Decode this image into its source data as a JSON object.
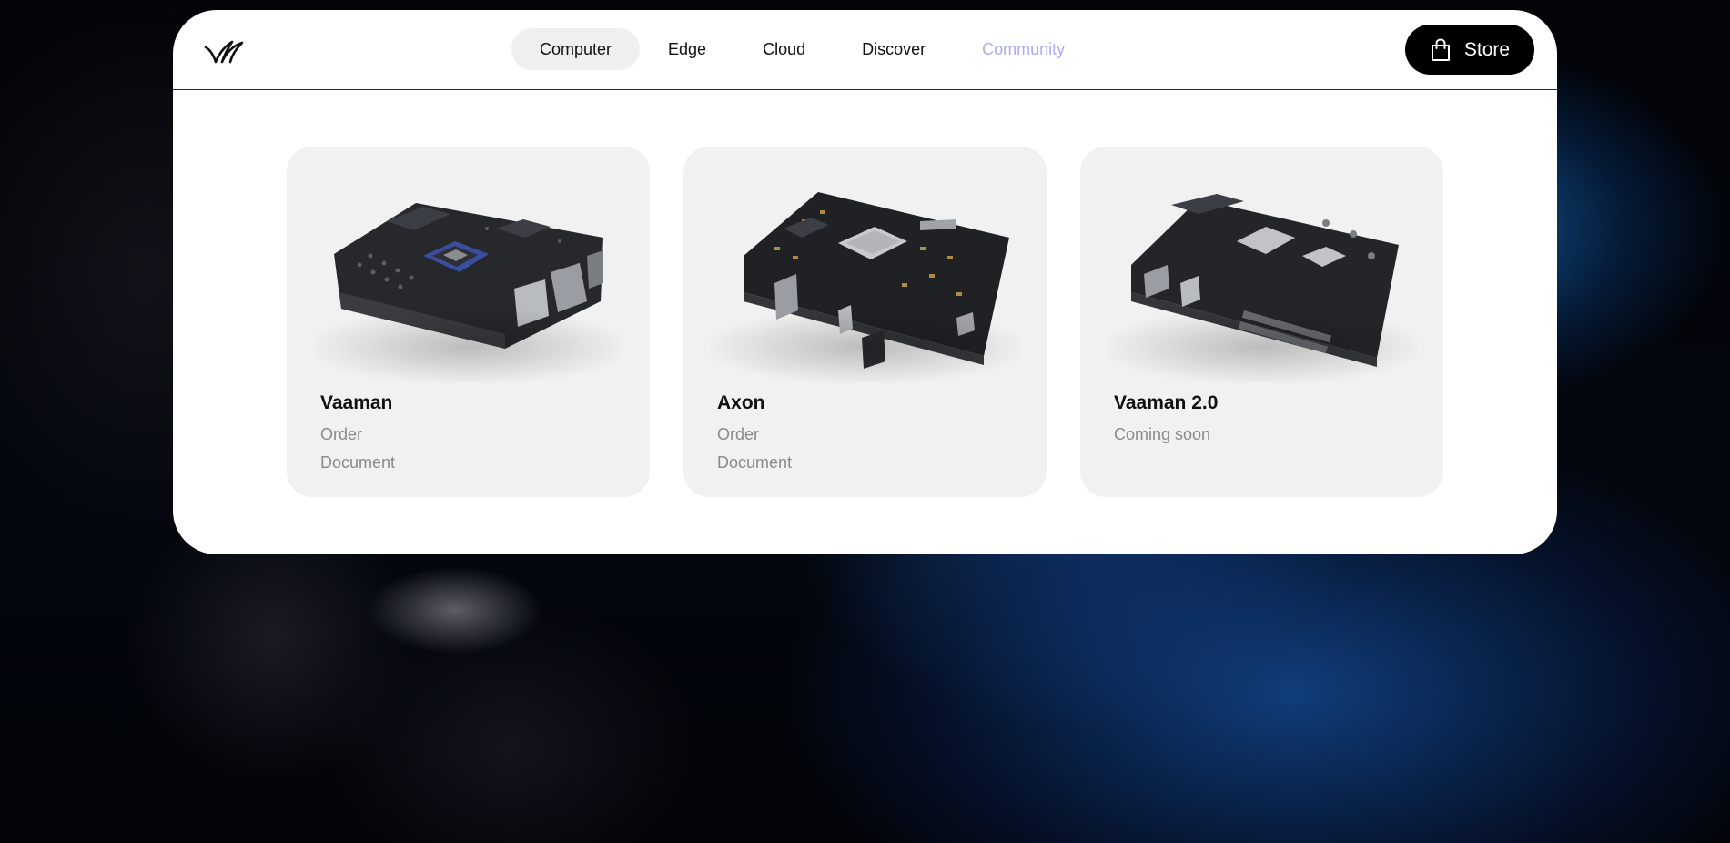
{
  "brand": {
    "logo_icon": "vicharak-logo-icon"
  },
  "nav": {
    "items": [
      {
        "label": "Computer",
        "active": true
      },
      {
        "label": "Edge"
      },
      {
        "label": "Cloud"
      },
      {
        "label": "Discover"
      },
      {
        "label": "Community",
        "muted": true
      }
    ]
  },
  "store": {
    "label": "Store",
    "icon": "shopping-bag-icon"
  },
  "products": [
    {
      "title": "Vaaman",
      "links": [
        "Order",
        "Document"
      ],
      "image": "vaaman-board"
    },
    {
      "title": "Axon",
      "links": [
        "Order",
        "Document"
      ],
      "image": "axon-board"
    },
    {
      "title": "Vaaman 2.0",
      "links": [
        "Coming soon"
      ],
      "image": "vaaman-2-board"
    }
  ],
  "colors": {
    "accent_muted": "#a9acef",
    "button_bg": "#000000",
    "card_bg": "#f1f1f1",
    "link_gray": "#8a8a8a"
  }
}
